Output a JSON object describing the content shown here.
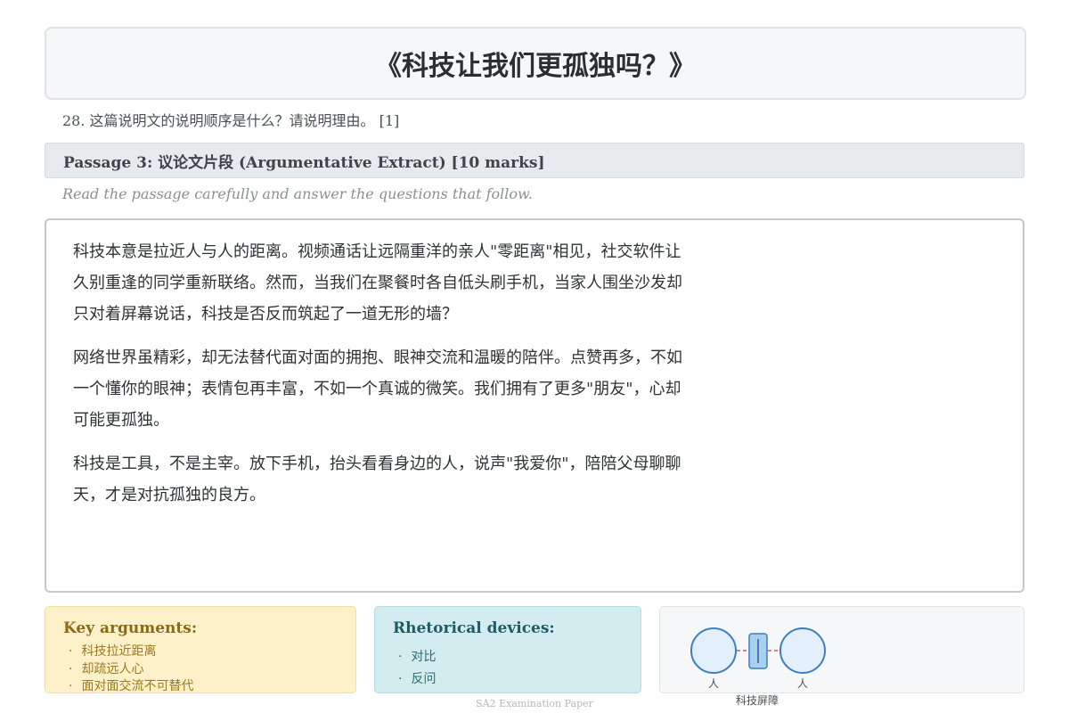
{
  "title": "《科技让我们更孤独吗？》",
  "question": "28. 这篇说明文的说明顺序是什么？请说明理由。 [1]",
  "passage_header": "Passage 3: 议论文片段 (Argumentative Extract) [10 marks]",
  "instruction": "Read the passage carefully and answer the questions that follow.",
  "passage": {
    "p1": "科技本意是拉近人与人的距离。视频通话让远隔重洋的亲人\"零距离\"相见，社交软件让久别重逢的同学重新联络。然而，当我们在聚餐时各自低头刷手机，当家人围坐沙发却只对着屏幕说话，科技是否反而筑起了一道无形的墙？",
    "p2": "网络世界虽精彩，却无法替代面对面的拥抱、眼神交流和温暖的陪伴。点赞再多，不如一个懂你的眼神；表情包再丰富，不如一个真诚的微笑。我们拥有了更多\"朋友\"，心却可能更孤独。",
    "p3": "科技是工具，不是主宰。放下手机，抬头看看身边的人，说声\"我爱你\"，陪陪父母聊聊天，才是对抗孤独的良方。"
  },
  "key_arguments": {
    "heading": "Key arguments:",
    "items": [
      "科技拉近距离",
      "却疏远人心",
      "面对面交流不可替代"
    ]
  },
  "rhetorical_devices": {
    "heading": "Rhetorical devices:",
    "items": [
      "对比",
      "反问"
    ]
  },
  "figure": {
    "left_label": "人",
    "right_label": "人",
    "caption": "科技屏障"
  },
  "footer": "SA2 Examination Paper",
  "colors": {
    "key_bg": "#fdf1c9",
    "rhet_bg": "#d3ecef",
    "circle_fill": "#e3f0fb",
    "circle_stroke": "#3b7fc0",
    "barrier_line": "#d9534f"
  }
}
